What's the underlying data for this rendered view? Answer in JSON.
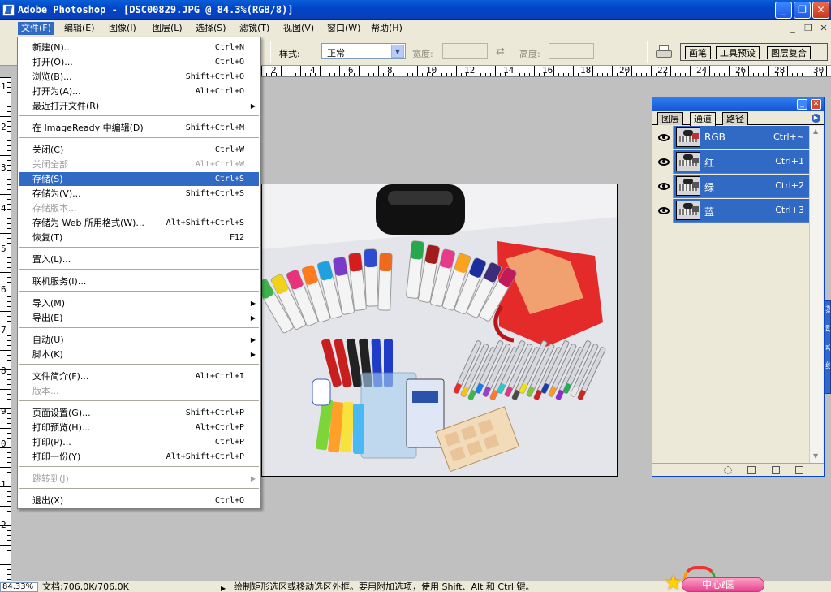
{
  "window": {
    "title": "Adobe Photoshop - [DSC00829.JPG @ 84.3%(RGB/8)]",
    "buttons": {
      "minimize": "_",
      "maximize": "❐",
      "close": "✕"
    }
  },
  "menubar": {
    "items": [
      "文件(F)",
      "编辑(E)",
      "图像(I)",
      "图层(L)",
      "选择(S)",
      "滤镜(T)",
      "视图(V)",
      "窗口(W)",
      "帮助(H)"
    ],
    "doc_controls": [
      "_",
      "❐",
      "✕"
    ]
  },
  "options": {
    "style_label": "样式:",
    "style_value": "正常",
    "width_label": "宽度:",
    "height_label": "高度:",
    "well_tabs": [
      "画笔",
      "工具预设",
      "图层复合"
    ]
  },
  "rulers": {
    "h_numbers": [
      "2",
      "4",
      "6",
      "8",
      "10",
      "12",
      "14",
      "16",
      "18",
      "20",
      "22",
      "24",
      "26",
      "28",
      "30"
    ],
    "v_numbers": [
      "1",
      "2",
      "3",
      "4",
      "5",
      "6",
      "7",
      "8",
      "9",
      "0",
      "1",
      "2"
    ]
  },
  "file_menu": {
    "items": [
      {
        "label": "新建(N)...",
        "shortcut": "Ctrl+N"
      },
      {
        "label": "打开(O)...",
        "shortcut": "Ctrl+O"
      },
      {
        "label": "浏览(B)...",
        "shortcut": "Shift+Ctrl+O"
      },
      {
        "label": "打开为(A)...",
        "shortcut": "Alt+Ctrl+O"
      },
      {
        "label": "最近打开文件(R)",
        "shortcut": "",
        "submenu": "▶"
      },
      {
        "label": "在 ImageReady 中编辑(D)",
        "shortcut": "Shift+Ctrl+M"
      },
      {
        "label": "关闭(C)",
        "shortcut": "Ctrl+W"
      },
      {
        "label": "关闭全部",
        "shortcut": "Alt+Ctrl+W"
      },
      {
        "label": "存储(S)",
        "shortcut": "Ctrl+S"
      },
      {
        "label": "存储为(V)...",
        "shortcut": "Shift+Ctrl+S"
      },
      {
        "label": "存储版本...",
        "shortcut": ""
      },
      {
        "label": "存储为 Web 所用格式(W)...",
        "shortcut": "Alt+Shift+Ctrl+S"
      },
      {
        "label": "恢复(T)",
        "shortcut": "F12"
      },
      {
        "label": "置入(L)...",
        "shortcut": ""
      },
      {
        "label": "联机服务(I)...",
        "shortcut": ""
      },
      {
        "label": "导入(M)",
        "shortcut": "",
        "submenu": "▶"
      },
      {
        "label": "导出(E)",
        "shortcut": "",
        "submenu": "▶"
      },
      {
        "label": "自动(U)",
        "shortcut": "",
        "submenu": "▶"
      },
      {
        "label": "脚本(K)",
        "shortcut": "",
        "submenu": "▶"
      },
      {
        "label": "文件简介(F)...",
        "shortcut": "Alt+Ctrl+I"
      },
      {
        "label": "版本...",
        "shortcut": ""
      },
      {
        "label": "页面设置(G)...",
        "shortcut": "Shift+Ctrl+P"
      },
      {
        "label": "打印预览(H)...",
        "shortcut": "Alt+Ctrl+P"
      },
      {
        "label": "打印(P)...",
        "shortcut": "Ctrl+P"
      },
      {
        "label": "打印一份(Y)",
        "shortcut": "Alt+Shift+Ctrl+P"
      },
      {
        "label": "跳转到(J)",
        "shortcut": "",
        "submenu": "▶"
      },
      {
        "label": "退出(X)",
        "shortcut": "Ctrl+Q"
      }
    ]
  },
  "channels_palette": {
    "tabs": [
      "图层",
      "通道",
      "路径"
    ],
    "menu_glyph": "▶",
    "window_buttons": {
      "minimize": "_",
      "close": "✕"
    },
    "channels": [
      {
        "name": "RGB",
        "shortcut": "Ctrl+~"
      },
      {
        "name": "红",
        "shortcut": "Ctrl+1"
      },
      {
        "name": "绿",
        "shortcut": "Ctrl+2"
      },
      {
        "name": "蓝",
        "shortcut": "Ctrl+3"
      }
    ],
    "scroll_glyphs": {
      "up": "▲",
      "down": "▼"
    }
  },
  "side_strip": [
    "蒸",
    "动",
    "动",
    "线"
  ],
  "status": {
    "zoom": "84.33%",
    "doc_info": "文档:706.0K/706.0K",
    "arrow": "▶",
    "hint": "绘制矩形选区或移动选区外框。要用附加选项，使用 Shift、Alt 和 Ctrl 键。"
  },
  "badge": {
    "text": "中心ℓ园"
  },
  "colors": {
    "title_blue": "#0046c8",
    "menu_highlight": "#316ac5",
    "chrome": "#ece9d8",
    "workspace": "#c0c0c0"
  }
}
